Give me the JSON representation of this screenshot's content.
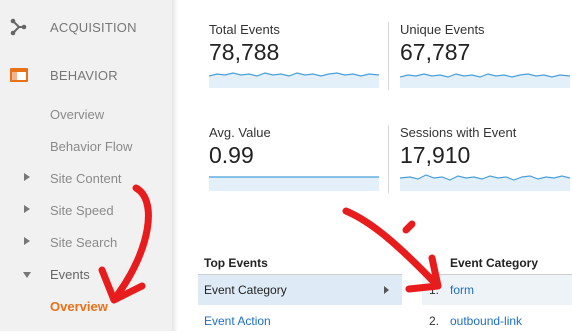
{
  "sidebar": {
    "sections": [
      {
        "label": "ACQUISITION",
        "icon": "acquisition-icon"
      },
      {
        "label": "BEHAVIOR",
        "icon": "behavior-icon"
      }
    ],
    "items": [
      {
        "label": "Overview"
      },
      {
        "label": "Behavior Flow"
      },
      {
        "label": "Site Content",
        "expander": "collapsed"
      },
      {
        "label": "Site Speed",
        "expander": "collapsed"
      },
      {
        "label": "Site Search",
        "expander": "collapsed"
      },
      {
        "label": "Events",
        "expander": "expanded"
      },
      {
        "label": "Overview",
        "active": true
      }
    ]
  },
  "metrics": [
    {
      "label": "Total Events",
      "value": "78,788"
    },
    {
      "label": "Unique Events",
      "value": "67,787"
    },
    {
      "label": "Avg. Value",
      "value": "0.99"
    },
    {
      "label": "Sessions with Event",
      "value": "17,910"
    }
  ],
  "top_events": {
    "header": "Top Events",
    "rows": [
      {
        "label": "Event Category",
        "selected": true
      },
      {
        "label": "Event Action",
        "selected": false
      }
    ]
  },
  "category_table": {
    "header": "Event Category",
    "rows": [
      {
        "rank": "1.",
        "label": "form"
      },
      {
        "rank": "2.",
        "label": "outbound-link"
      }
    ]
  },
  "colors": {
    "accent": "#e8711a",
    "link": "#1f6fbf",
    "sparkline": "#4a9fd9",
    "annotation_arrow": "#e81c1c",
    "selected_row": "#deebf6"
  }
}
